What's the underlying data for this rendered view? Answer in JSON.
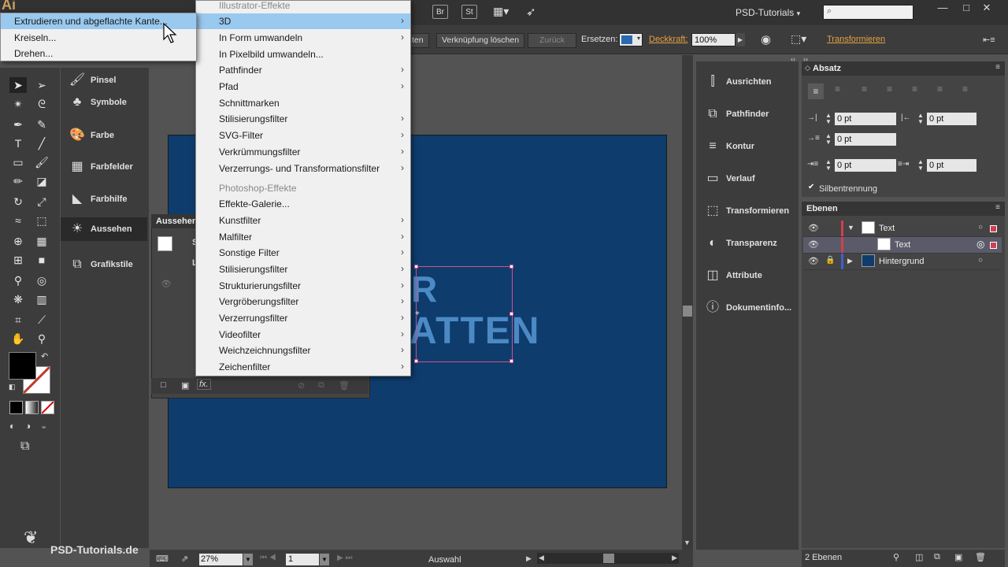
{
  "app": {
    "logo": "Ai",
    "workspace": "PSD-Tutorials",
    "workspace_arrow": "▾"
  },
  "topbar": {
    "br_label": "Br",
    "st_label": "St"
  },
  "window_controls": {
    "minimize": "—",
    "maximize": "□",
    "close": "✕"
  },
  "control_bar": {
    "trace_button_partial": "ten",
    "unlink_button": "Verknüpfung löschen",
    "back_button": "Zurück",
    "replace_label": "Ersetzen:",
    "opacity_label": "Deckkraft:",
    "opacity_value": "100%",
    "transform_link": "Transformieren"
  },
  "left_dock": [
    {
      "label": "Pinsel",
      "icon": "brush-icon"
    },
    {
      "label": "Symbole",
      "icon": "symbols-icon"
    },
    {
      "label": "Farbe",
      "icon": "color-icon"
    },
    {
      "label": "Farbfelder",
      "icon": "swatches-icon"
    },
    {
      "label": "Farbhilfe",
      "icon": "color-guide-icon"
    },
    {
      "label": "Aussehen",
      "icon": "appearance-icon"
    },
    {
      "label": "Grafikstile",
      "icon": "graphic-styles-icon"
    }
  ],
  "appearance_panel": {
    "title": "Aussehen",
    "col_partial": "S",
    "row_partial": "L"
  },
  "artboard_text": {
    "line1": "R",
    "line2": "ATTEN"
  },
  "statusbar": {
    "zoom": "27%",
    "page": "1",
    "status": "Auswahl"
  },
  "right_dock": [
    {
      "label": "Ausrichten",
      "icon": "align-icon"
    },
    {
      "label": "Pathfinder",
      "icon": "pathfinder-icon"
    },
    {
      "label": "Kontur",
      "icon": "stroke-icon"
    },
    {
      "label": "Verlauf",
      "icon": "gradient-icon"
    },
    {
      "label": "Transformieren",
      "icon": "transform-icon"
    },
    {
      "label": "Transparenz",
      "icon": "transparency-icon"
    },
    {
      "label": "Attribute",
      "icon": "attributes-icon"
    },
    {
      "label": "Dokumentinfo...",
      "icon": "document-info-icon"
    }
  ],
  "paragraph_panel": {
    "title": "Absatz",
    "fields": [
      "0 pt",
      "0 pt",
      "0 pt",
      "0 pt",
      "0 pt"
    ],
    "hyphenation": "Silbentrennung"
  },
  "layers_panel": {
    "title": "Ebenen",
    "rows": [
      {
        "name": "Text"
      },
      {
        "name": "Text"
      },
      {
        "name": "Hintergrund"
      }
    ],
    "count": "2 Ebenen"
  },
  "effect_menu": {
    "illustrator_header": "Illustrator-Effekte",
    "illustrator_items": [
      {
        "label": "3D",
        "submenu": true
      },
      {
        "label": "In Form umwandeln",
        "submenu": true
      },
      {
        "label": "In Pixelbild umwandeln...",
        "submenu": false
      },
      {
        "label": "Pathfinder",
        "submenu": true
      },
      {
        "label": "Pfad",
        "submenu": true
      },
      {
        "label": "Schnittmarken",
        "submenu": false
      },
      {
        "label": "Stilisierungsfilter",
        "submenu": true
      },
      {
        "label": "SVG-Filter",
        "submenu": true
      },
      {
        "label": "Verkrümmungsfilter",
        "submenu": true
      },
      {
        "label": "Verzerrungs- und Transformationsfilter",
        "submenu": true
      }
    ],
    "photoshop_header": "Photoshop-Effekte",
    "photoshop_items": [
      {
        "label": "Effekte-Galerie...",
        "submenu": false
      },
      {
        "label": "Kunstfilter",
        "submenu": true
      },
      {
        "label": "Malfilter",
        "submenu": true
      },
      {
        "label": "Sonstige Filter",
        "submenu": true
      },
      {
        "label": "Stilisierungsfilter",
        "submenu": true
      },
      {
        "label": "Strukturierungsfilter",
        "submenu": true
      },
      {
        "label": "Vergröberungsfilter",
        "submenu": true
      },
      {
        "label": "Verzerrungsfilter",
        "submenu": true
      },
      {
        "label": "Videofilter",
        "submenu": true
      },
      {
        "label": "Weichzeichnungsfilter",
        "submenu": true
      },
      {
        "label": "Zeichenfilter",
        "submenu": true
      }
    ]
  },
  "submenu_3d": [
    "Extrudieren und abgeflachte Kante...",
    "Kreiseln...",
    "Drehen..."
  ],
  "watermark": "PSD-Tutorials.de",
  "colors": {
    "artboard": "#0e3c6d",
    "menu_highlight": "#99c9ef",
    "selection": "#d05090",
    "accent": "#e6a040"
  }
}
